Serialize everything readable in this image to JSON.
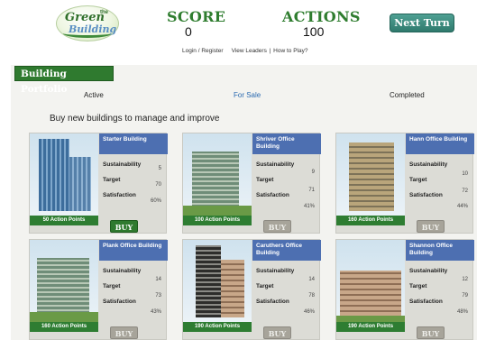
{
  "logo": {
    "line1": "Green",
    "the": "the",
    "line2": "Building"
  },
  "score": {
    "label": "SCORE",
    "value": "0"
  },
  "actions": {
    "label": "ACTIONS",
    "value": "100"
  },
  "next_turn_label": "Next Turn",
  "links": {
    "login": "Login / Register",
    "leaders": "View Leaders",
    "separator": "|",
    "howto": "How to Play?"
  },
  "portfolio": {
    "title": "Building Portfolio",
    "tabs": [
      "Active",
      "For Sale",
      "Completed"
    ],
    "subtitle": "Buy new buildings to manage and improve"
  },
  "stat_labels": {
    "sustainability": "Sustainability",
    "target": "Target",
    "satisfaction": "Satisfaction"
  },
  "buy_label": "BUY",
  "buildings": [
    {
      "name": "Starter Building",
      "sustainability": "5",
      "target": "70",
      "satisfaction": "60%",
      "action_points": "50 Action Points",
      "buy_enabled": true
    },
    {
      "name": "Shriver Office Building",
      "sustainability": "9",
      "target": "71",
      "satisfaction": "41%",
      "action_points": "100 Action Points",
      "buy_enabled": false
    },
    {
      "name": "Hann Office Building",
      "sustainability": "10",
      "target": "72",
      "satisfaction": "44%",
      "action_points": "160 Action Points",
      "buy_enabled": false
    },
    {
      "name": "Plank Office Building",
      "sustainability": "14",
      "target": "73",
      "satisfaction": "43%",
      "action_points": "160 Action Points",
      "buy_enabled": false
    },
    {
      "name": "Caruthers Office Building",
      "sustainability": "14",
      "target": "78",
      "satisfaction": "46%",
      "action_points": "190 Action Points",
      "buy_enabled": false
    },
    {
      "name": "Shannon Office Building",
      "sustainability": "12",
      "target": "79",
      "satisfaction": "48%",
      "action_points": "190 Action Points",
      "buy_enabled": false
    }
  ],
  "colors": {
    "green": "#2f7a2f",
    "blue_header": "#4d6fb1",
    "teal_button": "#2f7a6d",
    "buy_disabled": "#a7a49a"
  },
  "icons": {
    "logo": "green-the-building-logo"
  }
}
